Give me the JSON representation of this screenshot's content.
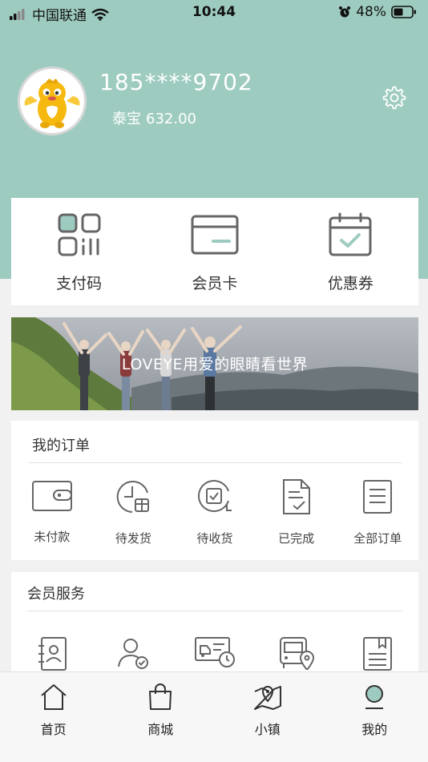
{
  "status_bar": {
    "carrier": "中国联通",
    "time": "10:44",
    "battery": "48%"
  },
  "profile": {
    "phone": "185****9702",
    "coin_label": "泰宝",
    "coin_value": "632.00"
  },
  "quick_actions": [
    {
      "label": "支付码",
      "icon": "qr-code-icon"
    },
    {
      "label": "会员卡",
      "icon": "member-card-icon"
    },
    {
      "label": "优惠券",
      "icon": "coupon-calendar-icon"
    }
  ],
  "banner": {
    "text": "LOVEYE用爱的眼睛看世界"
  },
  "orders": {
    "title": "我的订单",
    "items": [
      {
        "label": "未付款",
        "icon": "wallet-icon"
      },
      {
        "label": "待发货",
        "icon": "pending-shipment-icon"
      },
      {
        "label": "待收货",
        "icon": "pending-receipt-icon"
      },
      {
        "label": "已完成",
        "icon": "completed-document-icon"
      },
      {
        "label": "全部订单",
        "icon": "all-orders-icon"
      }
    ]
  },
  "services": {
    "title": "会员服务",
    "items": [
      {
        "icon": "contact-book-icon"
      },
      {
        "icon": "member-verified-icon"
      },
      {
        "icon": "delivery-truck-clock-icon"
      },
      {
        "icon": "bus-location-icon"
      },
      {
        "icon": "bookmark-notes-icon"
      }
    ]
  },
  "tabs": [
    {
      "label": "首页",
      "icon": "home-icon"
    },
    {
      "label": "商城",
      "icon": "shopping-bag-icon"
    },
    {
      "label": "小镇",
      "icon": "map-location-icon"
    },
    {
      "label": "我的",
      "icon": "profile-icon"
    }
  ],
  "colors": {
    "accent": "#9ecbc0",
    "icon_gray": "#666666",
    "background": "#f1f1f1"
  }
}
